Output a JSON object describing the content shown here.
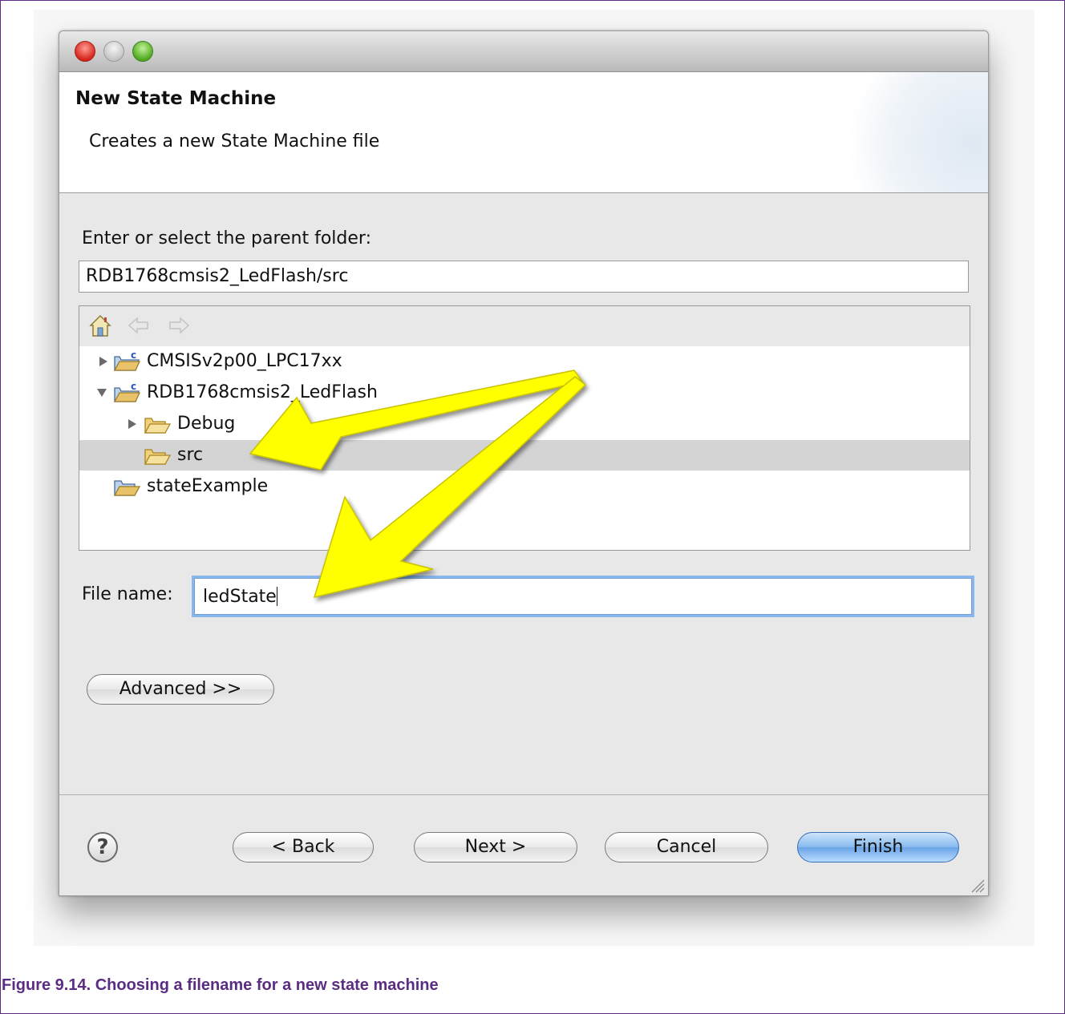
{
  "dialog": {
    "title": "New State Machine",
    "subtitle": "Creates a new State Machine file"
  },
  "folder": {
    "label": "Enter or select the parent folder:",
    "value": "RDB1768cmsis2_LedFlash/src"
  },
  "toolbar_icons": [
    "home-icon",
    "back-arrow-icon",
    "forward-arrow-icon"
  ],
  "tree": [
    {
      "label": "CMSISv2p00_LPC17xx",
      "icon": "c-project-folder-icon",
      "expanded": false
    },
    {
      "label": "RDB1768cmsis2_LedFlash",
      "icon": "c-project-folder-icon",
      "expanded": true
    },
    {
      "label": "Debug",
      "icon": "open-folder-icon",
      "expanded": false
    },
    {
      "label": "src",
      "icon": "open-folder-icon",
      "selected": true
    },
    {
      "label": "stateExample",
      "icon": "project-folder-icon"
    }
  ],
  "filename": {
    "label": "File name:",
    "value": "ledState"
  },
  "buttons": {
    "advanced": "Advanced >>",
    "back": "< Back",
    "next": "Next >",
    "cancel": "Cancel",
    "finish": "Finish",
    "help": "?"
  },
  "caption": "Figure 9.14. Choosing a filename for a new state machine",
  "colors": {
    "caption": "#5a2d82",
    "arrow": "#ffff00",
    "selection": "#d4d4d4",
    "focus_ring": "#8ab7ee"
  }
}
